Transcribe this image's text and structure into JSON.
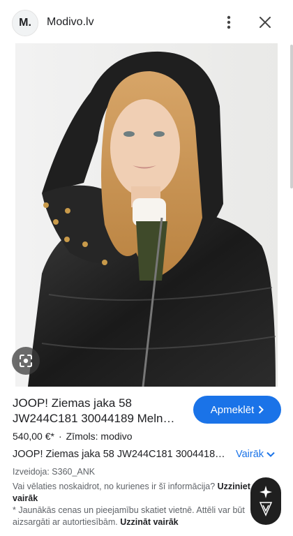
{
  "header": {
    "logo_text": "M.",
    "site_name": "Modivo.lv",
    "more_icon": "more-vert-icon",
    "close_icon": "close-icon"
  },
  "image": {
    "description_icon": "lens-icon"
  },
  "product": {
    "title": "JOOP! Ziemas jaka 58 JW244C181 30044189 Meln…",
    "visit_label": "Apmeklēt",
    "price": "540,00 €*",
    "brand": "Zīmols: modivo",
    "description": "JOOP! Ziemas jaka 58 JW244C181 3004418…",
    "more_label": "Vairāk",
    "made_by": "Izveidoja: S360_ANK",
    "notice_text_1": "Vai vēlaties noskaidrot, no kurienes ir šī informācija? ",
    "notice_link_1": "Uzziniet vairāk",
    "notice_text_2": "* Jaunākās cenas un pieejamību skatiet vietnē. Attēli var būt aizsargāti ar autortiesībām. ",
    "notice_link_2": "Uzzināt vairāk"
  },
  "colors": {
    "accent": "#1a73e8",
    "text": "#202124",
    "secondary_text": "#5f6368"
  }
}
